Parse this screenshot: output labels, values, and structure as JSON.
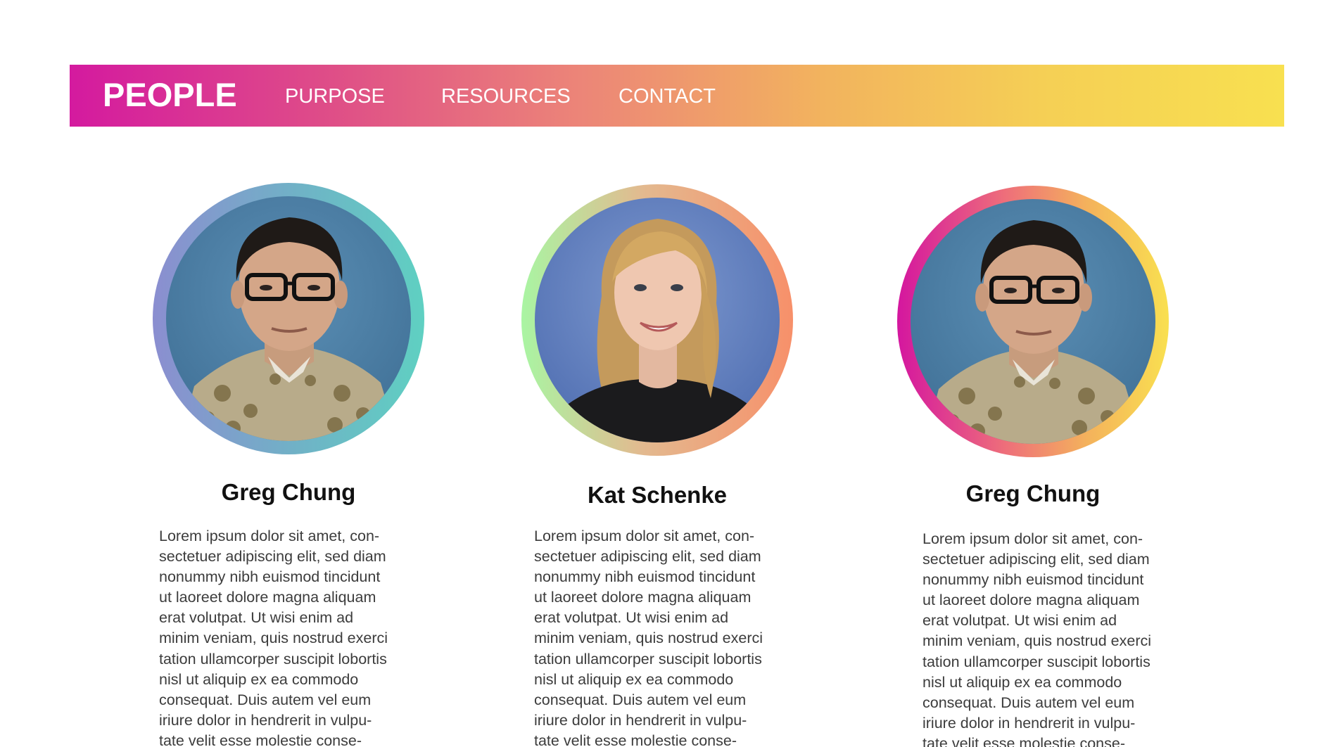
{
  "nav": {
    "logo": "PEOPLE",
    "links": [
      "PURPOSE",
      "RESOURCES",
      "CONTACT"
    ]
  },
  "colors": {
    "nav_gradient_start": "#d41a9f",
    "nav_gradient_end": "#f8e050",
    "name_text": "#111111",
    "bio_text": "#3c3c3c"
  },
  "people": [
    {
      "name": "Greg Chung",
      "bio": "Lorem ipsum dolor sit amet, con-\nsectetuer adipiscing elit, sed diam\nnonummy nibh euismod tincidunt\nut laoreet dolore magna aliquam\nerat volutpat. Ut wisi enim ad\nminim veniam, quis nostrud exerci\ntation ullamcorper suscipit lobortis\nnisl ut aliquip ex ea commodo\nconsequat. Duis autem vel eum\niriure dolor in hendrerit in vulpu-\ntate velit esse molestie conse-"
    },
    {
      "name": "Kat Schenke",
      "bio": "Lorem ipsum dolor sit amet, con-\nsectetuer adipiscing elit, sed diam\nnonummy nibh euismod tincidunt\nut laoreet dolore magna aliquam\nerat volutpat. Ut wisi enim ad\nminim veniam, quis nostrud exerci\ntation ullamcorper suscipit lobortis\nnisl ut aliquip ex ea commodo\nconsequat. Duis autem vel eum\niriure dolor in hendrerit in vulpu-\ntate velit esse molestie conse-"
    },
    {
      "name": "Greg Chung",
      "bio": "Lorem ipsum dolor sit amet, con-\nsectetuer adipiscing elit, sed diam\nnonummy nibh euismod tincidunt\nut laoreet dolore magna aliquam\nerat volutpat. Ut wisi enim ad\nminim veniam, quis nostrud exerci\ntation ullamcorper suscipit lobortis\nnisl ut aliquip ex ea commodo\nconsequat. Duis autem vel eum\niriure dolor in hendrerit in vulpu-\ntate velit esse molestie conse-"
    }
  ]
}
